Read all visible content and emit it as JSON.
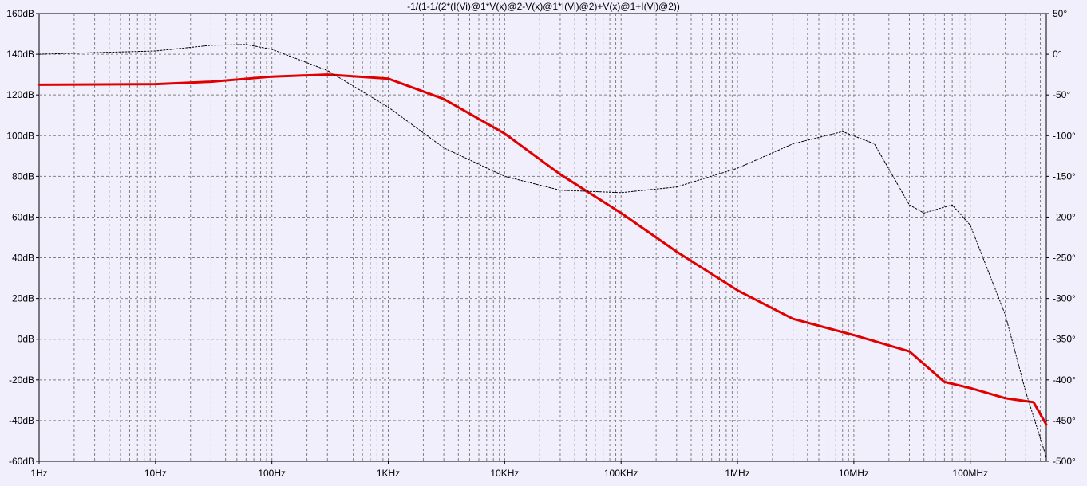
{
  "chart_data": {
    "type": "line",
    "title": "-1/(1-1/(2*(I(Vi)@1*V(x)@2-V(x)@1*I(Vi)@2)+V(x)@1+I(Vi)@2))",
    "x_scale": "log",
    "xlim": [
      1,
      450000000
    ],
    "x_tick_values": [
      1,
      10,
      100,
      1000,
      10000,
      100000,
      1000000,
      10000000,
      100000000
    ],
    "x_tick_labels": [
      "1Hz",
      "10Hz",
      "100Hz",
      "1KHz",
      "10KHz",
      "100KHz",
      "1MHz",
      "10MHz",
      "100MHz"
    ],
    "ylim_left": [
      -60,
      160
    ],
    "y_left_ticks": [
      "160dB",
      "140dB",
      "120dB",
      "100dB",
      "80dB",
      "60dB",
      "40dB",
      "20dB",
      "0dB",
      "-20dB",
      "-40dB",
      "-60dB"
    ],
    "ylim_right": [
      -500,
      50
    ],
    "y_right_ticks": [
      "50°",
      "0°",
      "-50°",
      "-100°",
      "-150°",
      "-200°",
      "-250°",
      "-300°",
      "-350°",
      "-400°",
      "-450°",
      "-500°"
    ],
    "grid": true,
    "series": [
      {
        "color": "#e00000",
        "style": "solid",
        "axis": "left",
        "x": [
          1,
          10,
          30,
          100,
          300,
          1000,
          3000,
          10000,
          30000,
          100000,
          300000,
          1000000,
          3000000,
          10000000,
          30000000,
          60000000,
          100000000,
          200000000,
          350000000,
          450000000
        ],
        "values": [
          125,
          125.3,
          126.5,
          129,
          130,
          128,
          118,
          101,
          81,
          62,
          43,
          24,
          10,
          2,
          -6,
          -21,
          -24,
          -29,
          -31,
          -42
        ]
      },
      {
        "color": "#000000",
        "style": "dashed",
        "axis": "right",
        "x": [
          1,
          10,
          30,
          60,
          100,
          300,
          1000,
          3000,
          10000,
          30000,
          100000,
          300000,
          1000000,
          3000000,
          8000000,
          15000000,
          30000000,
          40000000,
          70000000,
          100000000,
          200000000,
          300000000,
          450000000
        ],
        "values": [
          0,
          4,
          11,
          12,
          6,
          -20,
          -65,
          -115,
          -150,
          -167,
          -170,
          -163,
          -140,
          -110,
          -95,
          -110,
          -185,
          -195,
          -185,
          -210,
          -320,
          -415,
          -495
        ]
      }
    ]
  }
}
